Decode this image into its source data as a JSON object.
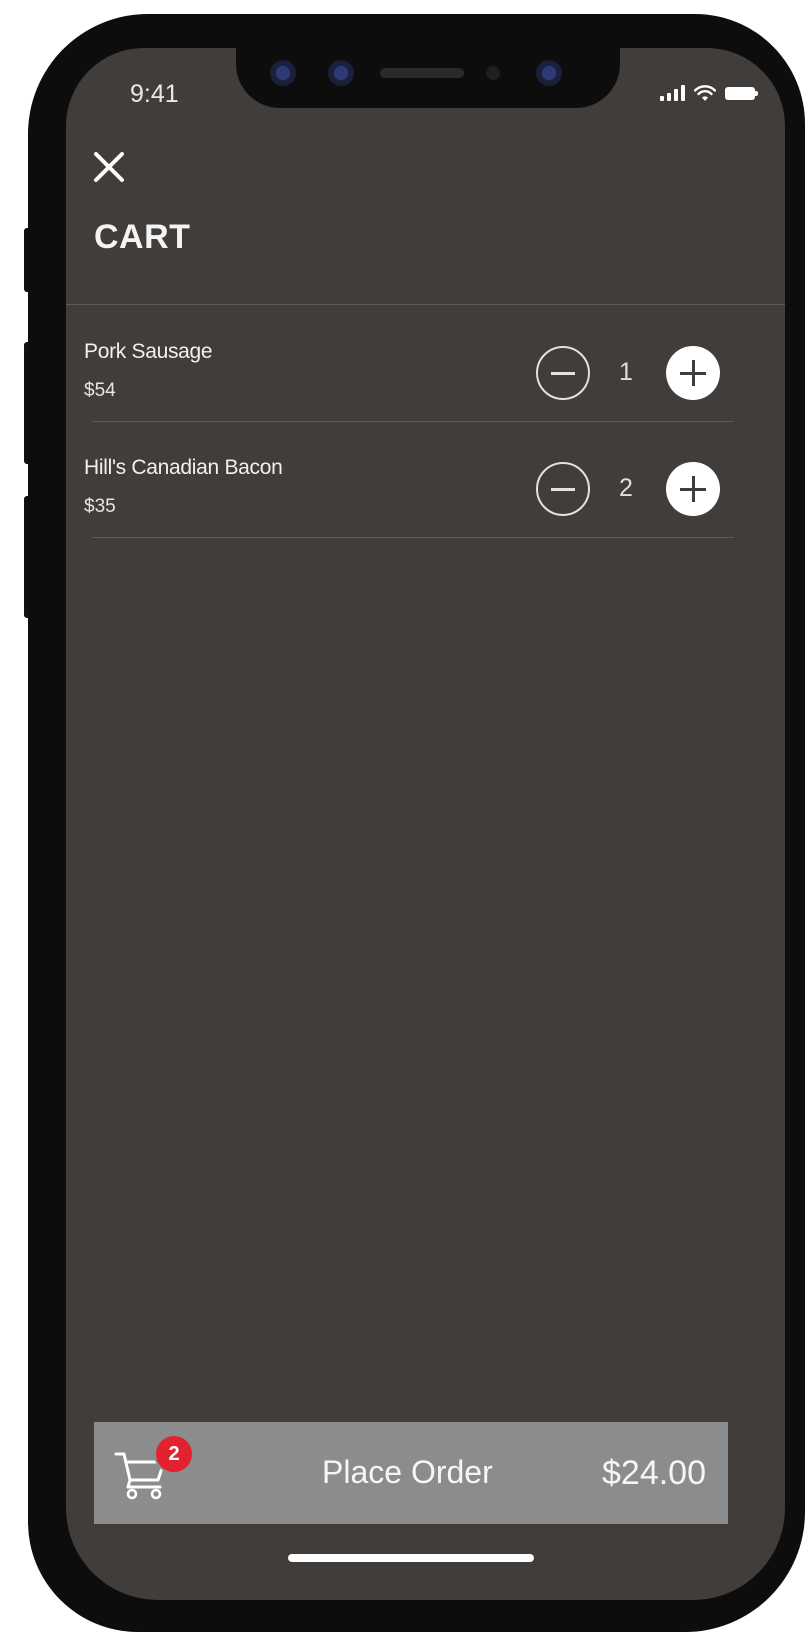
{
  "status_bar": {
    "time": "9:41"
  },
  "header": {
    "title": "CART"
  },
  "cart": {
    "items": [
      {
        "name": "Pork Sausage",
        "price": "$54",
        "quantity": "1"
      },
      {
        "name": "Hill's Canadian Bacon",
        "price": "$35",
        "quantity": "2"
      }
    ]
  },
  "footer": {
    "badge_count": "2",
    "place_order_label": "Place Order",
    "total": "$24.00"
  },
  "icons": {
    "close": "close-icon",
    "cart": "cart-icon",
    "minus": "minus-icon",
    "plus": "plus-icon"
  },
  "colors": {
    "screen_background": "#413d3a",
    "order_bar": "#8a8c8e",
    "badge": "#e2232f"
  }
}
